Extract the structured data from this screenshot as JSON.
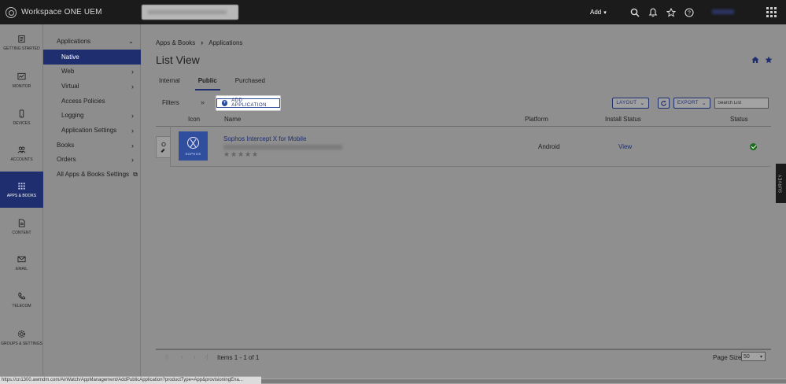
{
  "topbar": {
    "brand": "Workspace ONE UEM",
    "add_label": "Add",
    "icons": [
      "search-icon",
      "bell-icon",
      "star-icon",
      "help-icon",
      "apps-grid-icon"
    ]
  },
  "rail": [
    {
      "label": "Getting Started",
      "icon": "getting-started-icon"
    },
    {
      "label": "Monitor",
      "icon": "monitor-icon"
    },
    {
      "label": "Devices",
      "icon": "device-icon"
    },
    {
      "label": "Accounts",
      "icon": "accounts-icon"
    },
    {
      "label": "Apps & Books",
      "icon": "apps-icon",
      "active": true
    },
    {
      "label": "Content",
      "icon": "content-icon"
    },
    {
      "label": "Email",
      "icon": "email-icon"
    },
    {
      "label": "Telecom",
      "icon": "phone-icon"
    },
    {
      "label": "Groups & Settings",
      "icon": "gear-icon"
    }
  ],
  "subnav": {
    "section": "Applications",
    "items": [
      {
        "label": "Native",
        "active": true
      },
      {
        "label": "Web"
      },
      {
        "label": "Virtual"
      },
      {
        "label": "Access Policies"
      },
      {
        "label": "Logging"
      },
      {
        "label": "Application Settings"
      }
    ],
    "books": "Books",
    "orders": "Orders",
    "all_settings": "All Apps & Books Settings"
  },
  "main": {
    "breadcrumb": [
      "Apps & Books",
      "Applications"
    ],
    "title": "List View",
    "tabs": [
      "Internal",
      "Public",
      "Purchased"
    ],
    "active_tab": "Public",
    "filters": "Filters",
    "add_application": "ADD APPLICATION",
    "layout": "LAYOUT",
    "export": "EXPORT",
    "search_placeholder": "Search List",
    "columns": [
      "Icon",
      "Name",
      "Platform",
      "Install Status",
      "Status"
    ],
    "rows": [
      {
        "name": "Sophos Intercept X for Mobile",
        "icon_text": "SOPHOS",
        "rating": 0,
        "platform": "Android",
        "install_status": "View",
        "status": "active"
      }
    ],
    "pager": {
      "items_text": "Items 1 - 1 of 1",
      "page_size_label": "Page Size:",
      "page_size": "50"
    }
  },
  "survey": "SURVEY",
  "status_url": "https://cn1300.awmdm.com/AirWatch/AppManagement/AddPublicApplication?productType=App&provisioningEna..."
}
